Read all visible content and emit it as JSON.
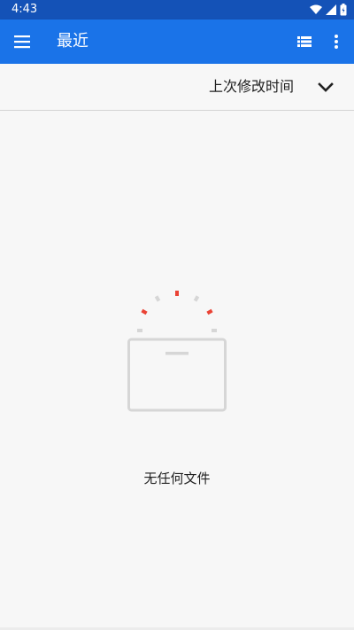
{
  "status_bar": {
    "time": "4:43",
    "icons": [
      "wifi-icon",
      "signal-icon",
      "battery-icon"
    ]
  },
  "app_bar": {
    "title": "最近",
    "icons": [
      "menu-icon",
      "list-view-icon",
      "more-vert-icon"
    ]
  },
  "sort": {
    "label": "上次修改时间",
    "icon": "chevron-down-icon"
  },
  "empty_state": {
    "message": "无任何文件",
    "icon": "empty-folder-illustration"
  },
  "colors": {
    "status_bar": "#1452b7",
    "app_bar": "#1a73e8",
    "background": "#f7f7f7",
    "accent_red": "#ea4335"
  }
}
